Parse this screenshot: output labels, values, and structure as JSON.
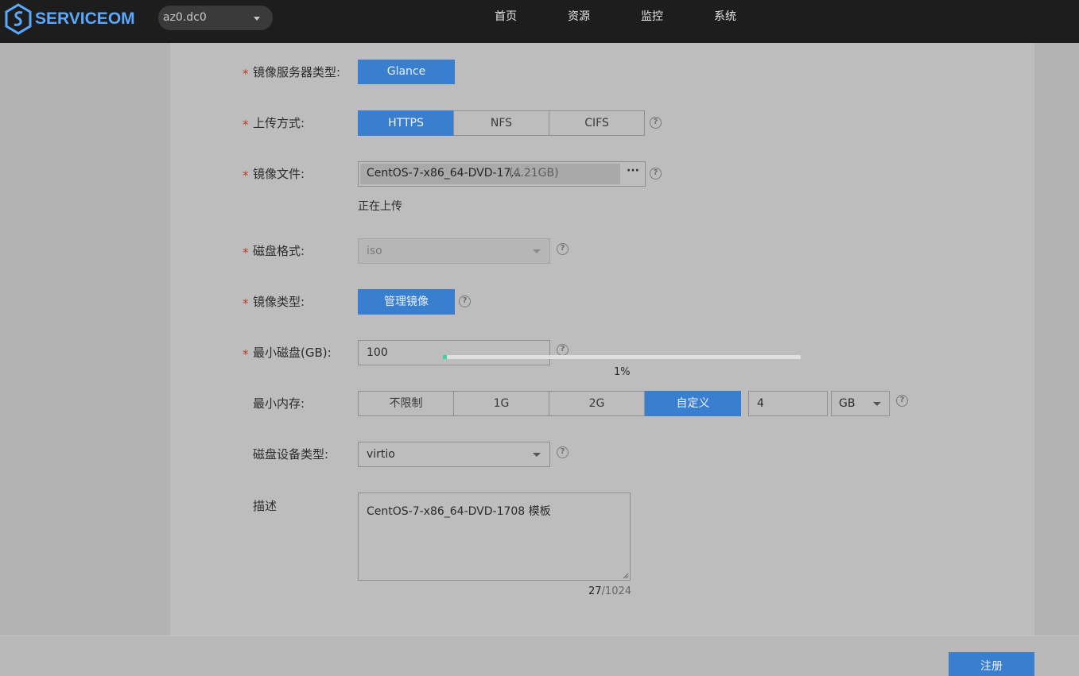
{
  "header": {
    "logo": "SERVICEOM",
    "region": "az0.dc0",
    "nav": [
      "首页",
      "资源",
      "监控",
      "系统"
    ]
  },
  "form": {
    "server_type": {
      "label": "镜像服务器类型:",
      "value": "Glance"
    },
    "upload": {
      "label": "上传方式:",
      "options": [
        "HTTPS",
        "NFS",
        "CIFS"
      ],
      "selected": "HTTPS"
    },
    "image_file": {
      "label": "镜像文件:",
      "name": "CentOS-7-x86_64-DVD-17...",
      "size": "(4.21GB)",
      "browse": "···",
      "status": "正在上传"
    },
    "disk_format": {
      "label": "磁盘格式:",
      "value": "iso"
    },
    "image_type": {
      "label": "镜像类型:",
      "value": "管理镜像"
    },
    "min_disk": {
      "label": "最小磁盘(GB):",
      "value": "100"
    },
    "progress": {
      "percent_text": "1%",
      "fraction": 0.01
    },
    "min_memory": {
      "label": "最小内存:",
      "options": [
        "不限制",
        "1G",
        "2G",
        "自定义"
      ],
      "selected": "自定义",
      "value": "4",
      "unit": "GB"
    },
    "disk_bus": {
      "label": "磁盘设备类型:",
      "value": "virtio"
    },
    "description": {
      "label": "描述",
      "value": "CentOS-7-x86_64-DVD-1708 模板",
      "count": "27",
      "max": "/1024"
    }
  },
  "footer": {
    "submit": "注册"
  },
  "colors": {
    "accent": "#3a7ecf",
    "required": "#c0392b",
    "progress": "#3fd3a0"
  }
}
